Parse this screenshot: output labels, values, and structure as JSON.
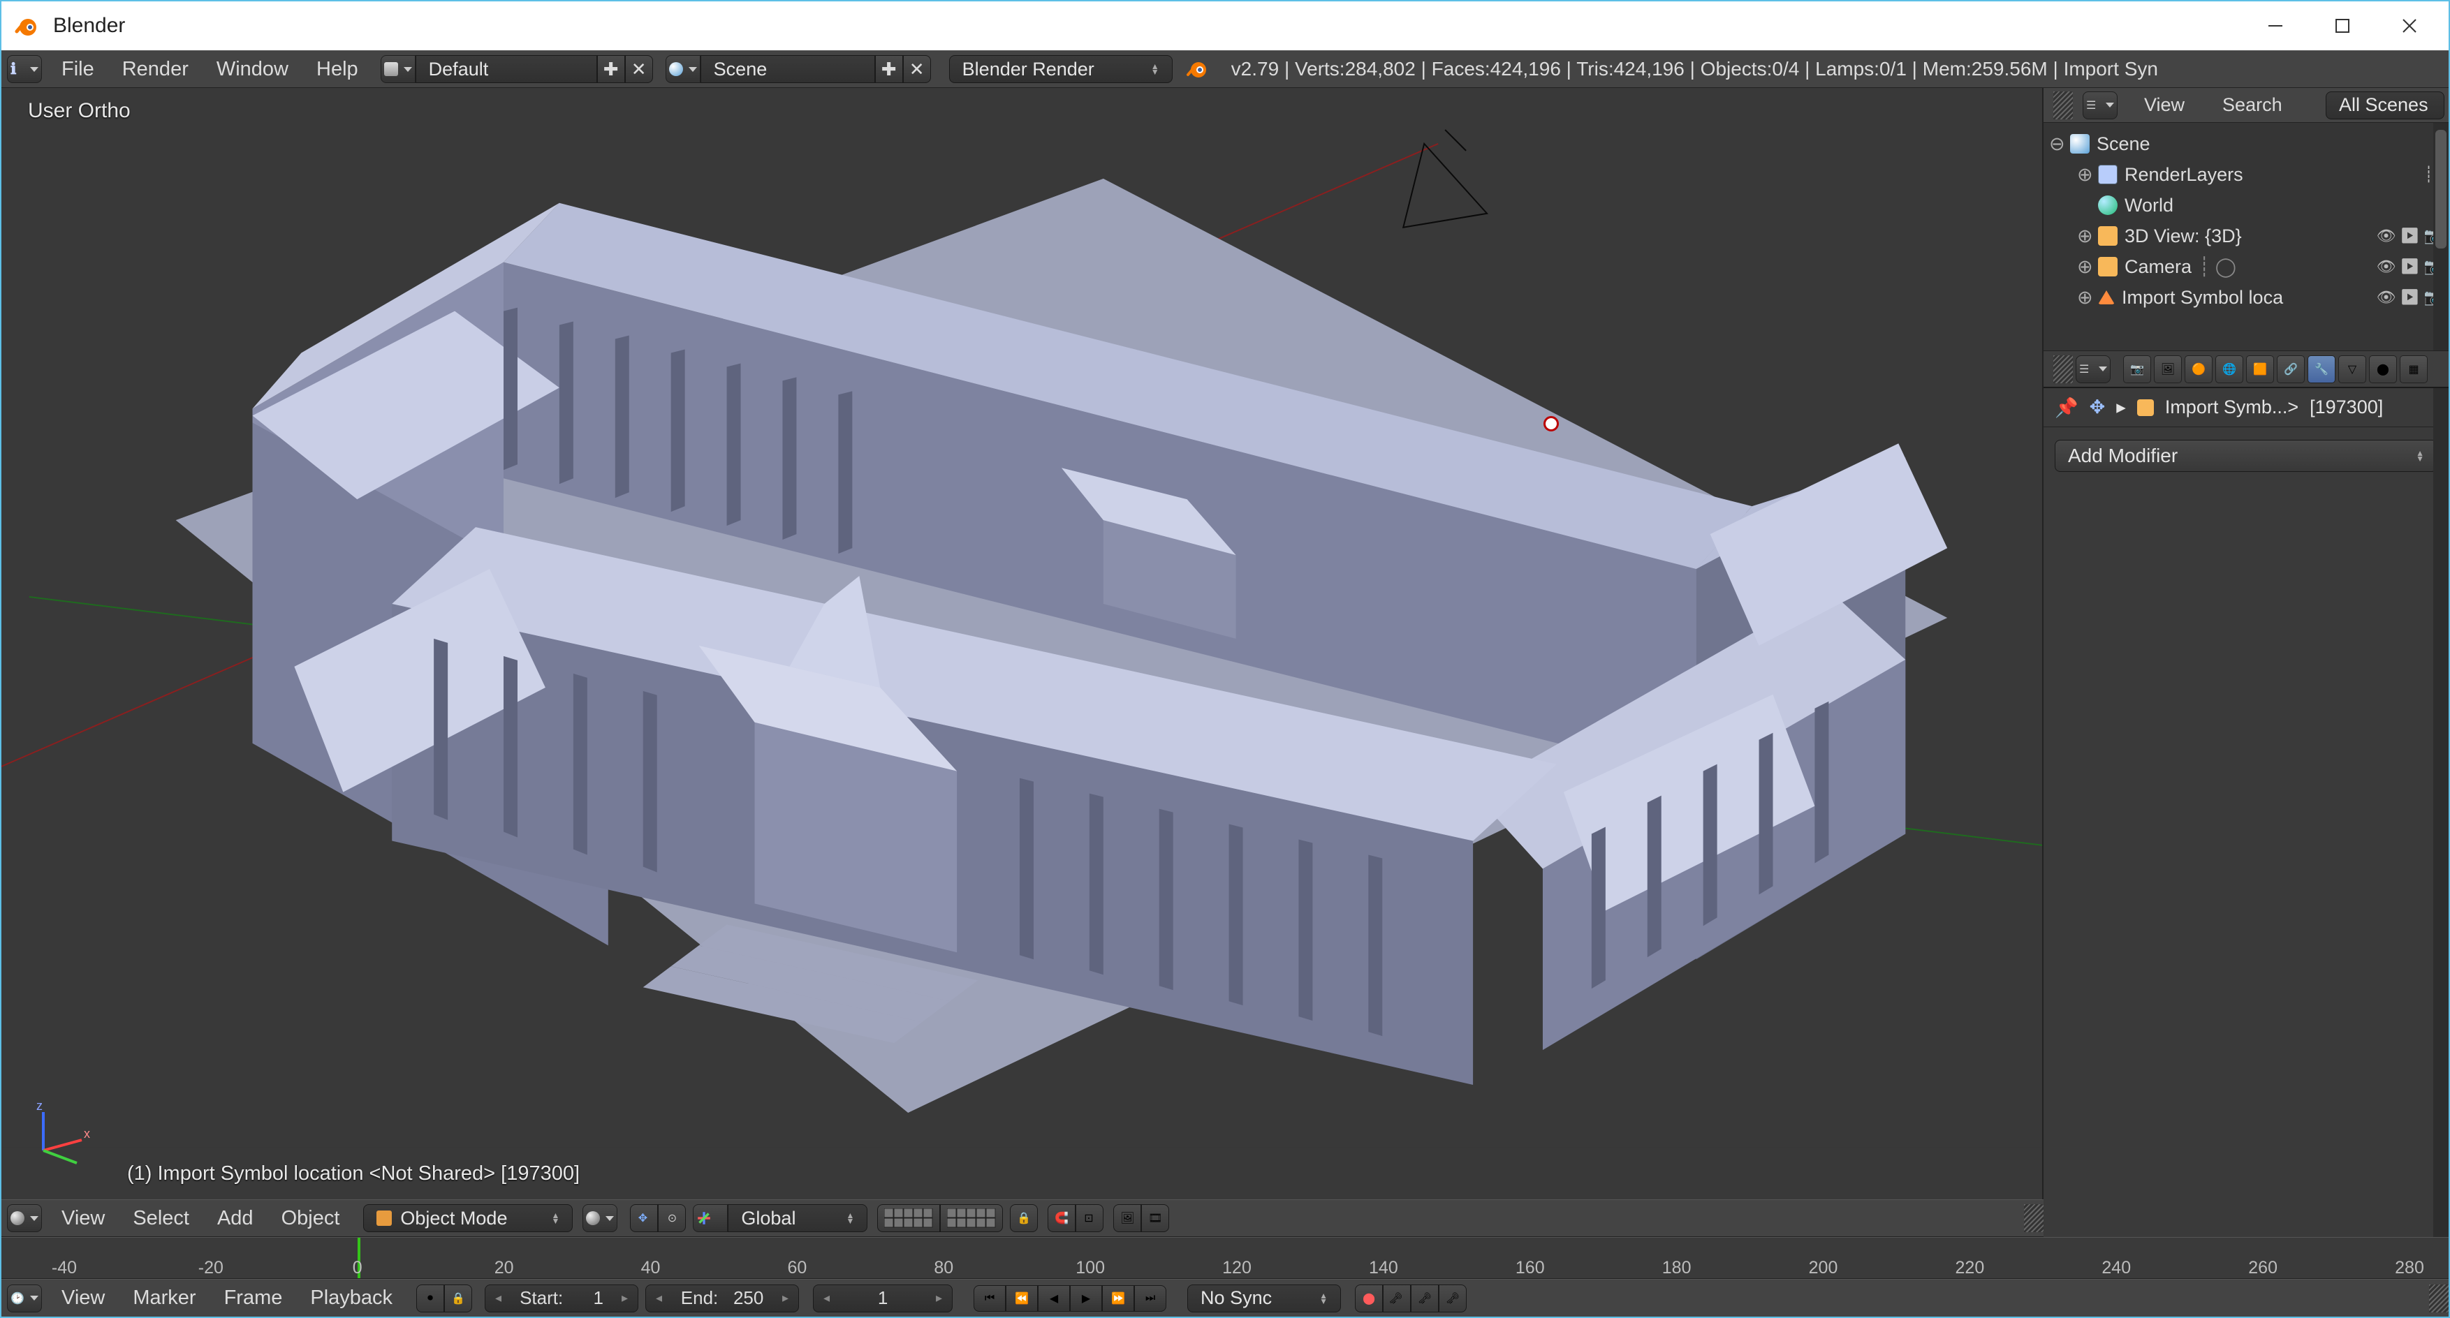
{
  "window": {
    "title": "Blender"
  },
  "info_header": {
    "menus": [
      "File",
      "Render",
      "Window",
      "Help"
    ],
    "layout": "Default",
    "scene": "Scene",
    "engine": "Blender Render",
    "version": "v2.79",
    "stats": {
      "verts": "284,802",
      "faces": "424,196",
      "tris": "424,196",
      "objects": "0/4",
      "lamps": "0/1",
      "mem": "259.56M",
      "tail": "Import Syn"
    }
  },
  "viewport": {
    "projection": "User Ortho",
    "selection_text": "(1) Import Symbol location <Not Shared> [197300]"
  },
  "view3d_header": {
    "menus": [
      "View",
      "Select",
      "Add",
      "Object"
    ],
    "mode": "Object Mode",
    "orientation": "Global"
  },
  "timeline": {
    "ticks": [
      -40,
      -20,
      0,
      20,
      40,
      60,
      80,
      100,
      120,
      140,
      160,
      180,
      200,
      220,
      240,
      260,
      280
    ],
    "current": 0
  },
  "timeline_header": {
    "menus": [
      "View",
      "Marker",
      "Frame",
      "Playback"
    ],
    "start_label": "Start:",
    "start_value": "1",
    "end_label": "End:",
    "end_value": "250",
    "current_value": "1",
    "sync": "No Sync"
  },
  "outliner": {
    "menus": [
      "View",
      "Search"
    ],
    "filter": "All Scenes",
    "items": {
      "scene": "Scene",
      "renderlayers": "RenderLayers",
      "world": "World",
      "view3d": "3D View: {3D}",
      "camera": "Camera",
      "import": "Import Symbol loca"
    }
  },
  "properties": {
    "breadcrumb_obj": "Import Symb...>",
    "breadcrumb_count": "[197300]",
    "add_modifier": "Add Modifier"
  }
}
